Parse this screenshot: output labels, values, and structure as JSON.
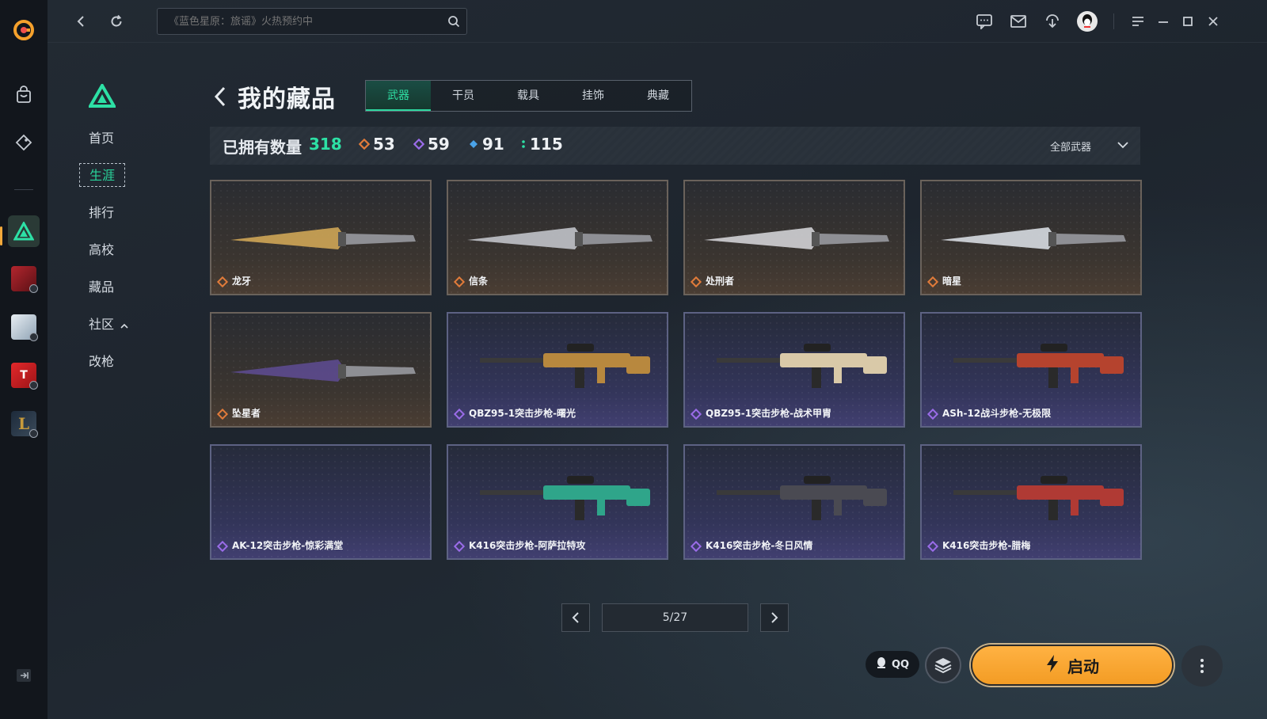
{
  "search": {
    "placeholder": "《蓝色星原：旅谣》火热预约中"
  },
  "nav": {
    "items": [
      {
        "label": "首页",
        "active": false
      },
      {
        "label": "生涯",
        "active": true
      },
      {
        "label": "排行",
        "active": false
      },
      {
        "label": "高校",
        "active": false
      },
      {
        "label": "藏品",
        "active": false
      },
      {
        "label": "社区",
        "active": false,
        "has_chevron": true
      },
      {
        "label": "改枪",
        "active": false
      }
    ]
  },
  "page": {
    "title": "我的藏品"
  },
  "tabs": [
    {
      "label": "武器",
      "active": true
    },
    {
      "label": "干员",
      "active": false
    },
    {
      "label": "载具",
      "active": false
    },
    {
      "label": "挂饰",
      "active": false
    },
    {
      "label": "典藏",
      "active": false
    }
  ],
  "stats": {
    "owned_label": "已拥有数量",
    "owned_total": "318",
    "rarities": [
      {
        "value": "53",
        "color": "#e07b3a"
      },
      {
        "value": "59",
        "color": "#9a6ce8"
      },
      {
        "value": "91",
        "color": "#4aa3e8"
      },
      {
        "value": "115",
        "color": "#2de0a5"
      }
    ],
    "filter_label": "全部武器"
  },
  "items": [
    {
      "name": "龙牙",
      "rarity": "gold",
      "kind": "knife"
    },
    {
      "name": "信条",
      "rarity": "gold",
      "kind": "knife"
    },
    {
      "name": "处刑者",
      "rarity": "gold",
      "kind": "knife"
    },
    {
      "name": "暗星",
      "rarity": "gold",
      "kind": "knife"
    },
    {
      "name": "坠星者",
      "rarity": "gold",
      "kind": "knife"
    },
    {
      "name": "QBZ95-1突击步枪-曙光",
      "rarity": "purple",
      "kind": "rifle"
    },
    {
      "name": "QBZ95-1突击步枪-战术甲胄",
      "rarity": "purple",
      "kind": "rifle"
    },
    {
      "name": "ASh-12战斗步枪-无极限",
      "rarity": "purple",
      "kind": "rifle"
    },
    {
      "name": "AK-12突击步枪-惊彩满堂",
      "rarity": "purple",
      "kind": "empty"
    },
    {
      "name": "K416突击步枪-阿萨拉特攻",
      "rarity": "purple",
      "kind": "rifle"
    },
    {
      "name": "K416突击步枪-冬日风情",
      "rarity": "purple",
      "kind": "rifle"
    },
    {
      "name": "K416突击步枪-腊梅",
      "rarity": "purple",
      "kind": "rifle"
    }
  ],
  "pagination": {
    "value": "5/27"
  },
  "bottom": {
    "qq_label": "QQ",
    "launch_label": "启动"
  },
  "colors": {
    "accent": "#2de0a5",
    "launch": "#f5a12c"
  }
}
